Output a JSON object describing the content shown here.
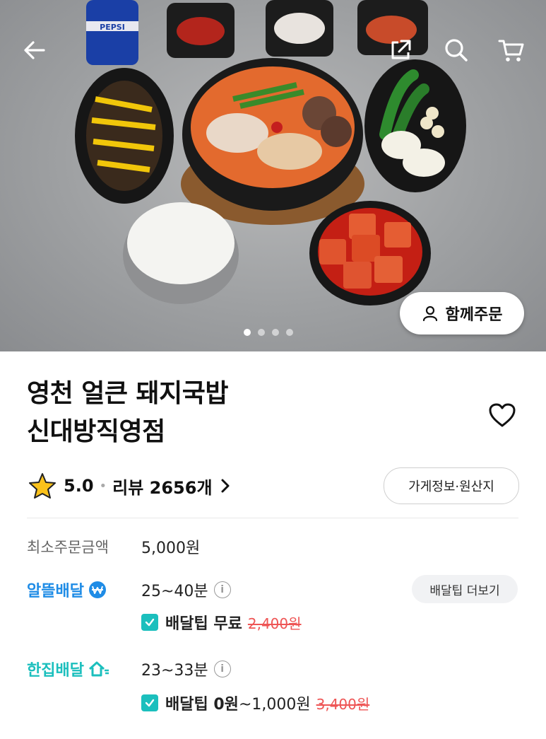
{
  "hero": {
    "together_order_label": "함께주문",
    "carousel_total": 4,
    "carousel_active": 1
  },
  "store": {
    "name_line1": "영천 얼큰 돼지국밥",
    "name_line2": "신대방직영점",
    "rating": "5.0",
    "review_label": "리뷰 2656개",
    "store_info_button": "가게정보·원산지"
  },
  "min_order": {
    "label": "최소주문금액",
    "value": "5,000원"
  },
  "delivery_saver": {
    "label": "알뜰배달",
    "time": "25~40분",
    "more_tip_button": "배달팁 더보기",
    "tip_label": "배달팁 무료",
    "tip_original": "2,400원",
    "label_color": "#1f8ce6"
  },
  "delivery_single": {
    "label": "한집배달",
    "time": "23~33분",
    "tip_label": "배달팁 0원",
    "tip_suffix": "~1,000원",
    "tip_original": "3,400원",
    "label_color": "#1bbfbd"
  },
  "icons": [
    "back-arrow-icon",
    "share-icon",
    "search-icon",
    "cart-icon",
    "person-icon",
    "heart-icon",
    "star-icon",
    "chevron-right-icon",
    "info-icon",
    "coupon-icon"
  ]
}
